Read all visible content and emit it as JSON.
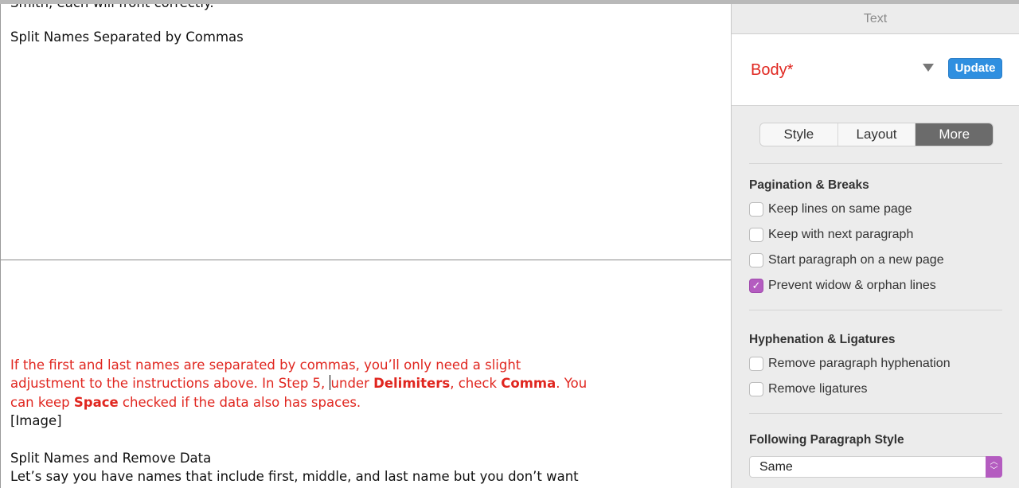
{
  "document": {
    "cut_line": "Smith, each will front correctly.",
    "heading1": "Split Names Separated by Commas",
    "red_paragraph": {
      "line1": "If the first and last names are separated by commas, you’ll only need a slight",
      "line2_a": "adjustment to the instructions above. In Step 5, ",
      "line2_b": "under ",
      "line2_bold1": "Delimiters",
      "line2_c": ", check ",
      "line2_bold2": "Comma",
      "line2_d": ". You",
      "line3_a": "can keep ",
      "line3_bold": "Space",
      "line3_b": " checked if the data also has spaces."
    },
    "image_placeholder": "[Image]",
    "heading2": "Split Names and Remove Data",
    "line_last": "Let’s say you have names that include first, middle, and last name but you don’t want"
  },
  "sidebar": {
    "title": "Text",
    "paragraph_style": "Body*",
    "update_label": "Update",
    "tabs": [
      {
        "label": "Style"
      },
      {
        "label": "Layout"
      },
      {
        "label": "More",
        "active": true
      }
    ],
    "pagination": {
      "title": "Pagination & Breaks",
      "options": [
        {
          "label": "Keep lines on same page",
          "checked": false
        },
        {
          "label": "Keep with next paragraph",
          "checked": false
        },
        {
          "label": "Start paragraph on a new page",
          "checked": false
        },
        {
          "label": "Prevent widow & orphan lines",
          "checked": true
        }
      ]
    },
    "hyphenation": {
      "title": "Hyphenation & Ligatures",
      "options": [
        {
          "label": "Remove paragraph hyphenation",
          "checked": false
        },
        {
          "label": "Remove ligatures",
          "checked": false
        }
      ]
    },
    "following": {
      "title": "Following Paragraph Style",
      "value": "Same"
    }
  },
  "colors": {
    "accent": "#b45cc0",
    "update_button": "#2f8fe0",
    "modified_text": "#e0261f"
  }
}
